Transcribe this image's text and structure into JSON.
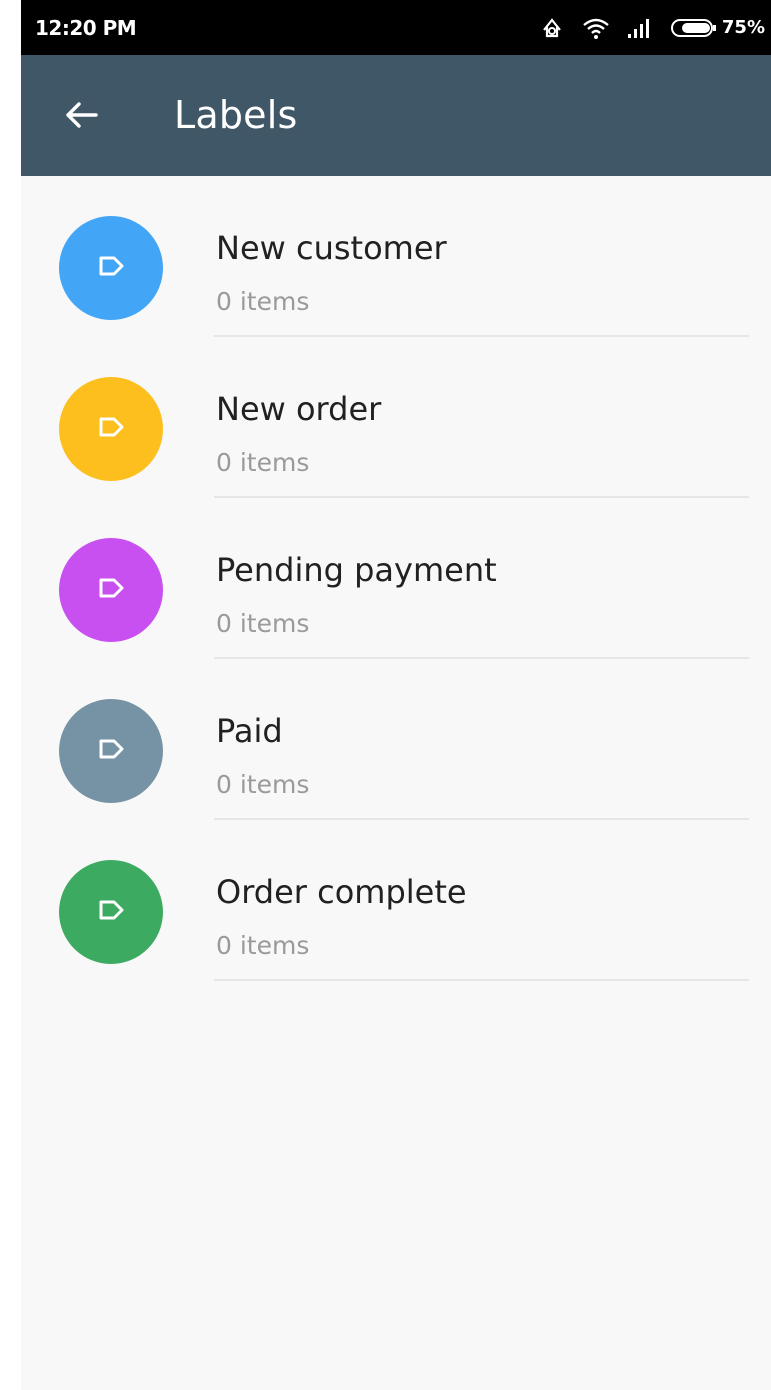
{
  "status_bar": {
    "time": "12:20 PM",
    "battery_percent": "75%",
    "icons": [
      "sync-icon",
      "wifi-icon",
      "signal-icon",
      "battery-icon"
    ]
  },
  "app_bar": {
    "title": "Labels",
    "back_icon": "arrow-back-icon"
  },
  "labels": [
    {
      "name": "New customer",
      "count": "0 items",
      "color": "#42a5f5"
    },
    {
      "name": "New order",
      "count": "0 items",
      "color": "#fcbf1e"
    },
    {
      "name": "Pending payment",
      "count": "0 items",
      "color": "#c84ff0"
    },
    {
      "name": "Paid",
      "count": "0 items",
      "color": "#7693a6"
    },
    {
      "name": "Order complete",
      "count": "0 items",
      "color": "#3daa62"
    }
  ],
  "colors": {
    "app_bar": "#3f5766",
    "background": "#f8f8f8"
  }
}
